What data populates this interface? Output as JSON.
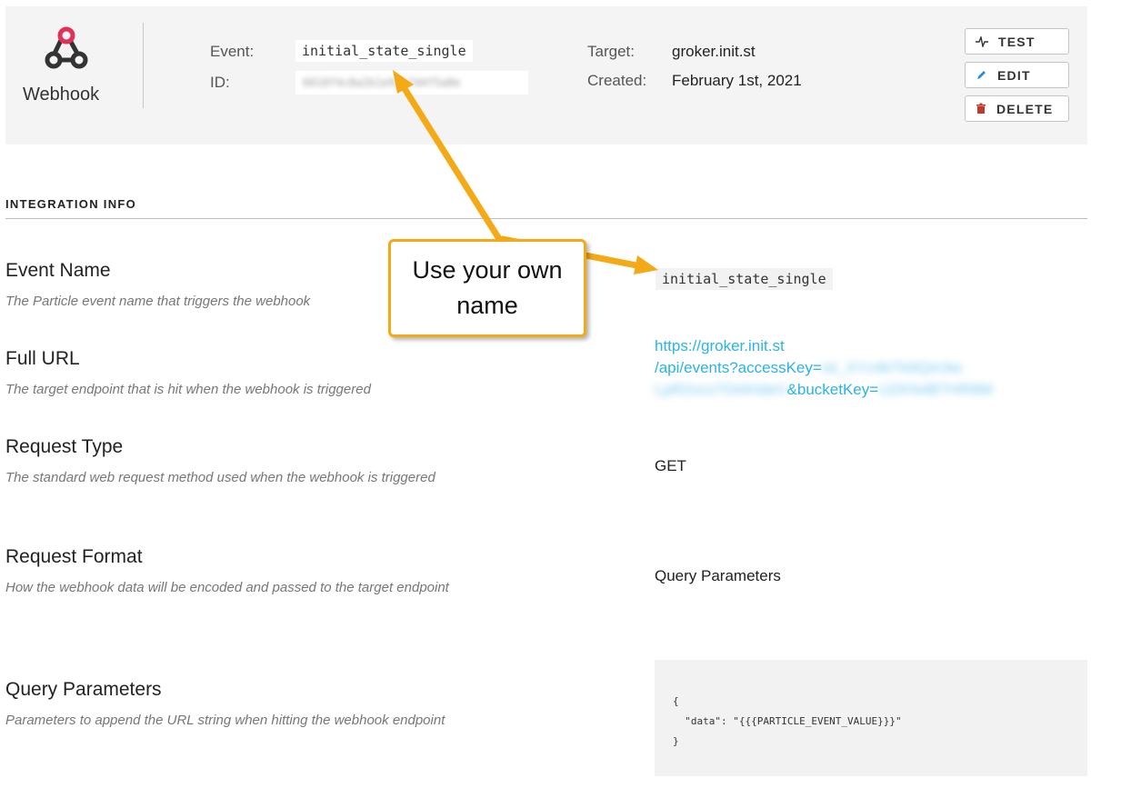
{
  "header": {
    "brand_label": "Webhook",
    "event_label": "Event:",
    "event_value": "initial_state_single",
    "id_label": "ID:",
    "id_value": "6018f4c8a2b1e93c7d4f5a0e",
    "target_label": "Target:",
    "target_value": "groker.init.st",
    "created_label": "Created:",
    "created_value": "February 1st, 2021",
    "buttons": {
      "test": "TEST",
      "edit": "EDIT",
      "delete": "DELETE"
    }
  },
  "section_title": "INTEGRATION INFO",
  "rows": {
    "event_name": {
      "title": "Event Name",
      "desc": "The Particle event name that triggers the webhook",
      "value": "initial_state_single"
    },
    "full_url": {
      "title": "Full URL",
      "desc": "The target endpoint that is hit when the webhook is triggered",
      "line1": "https://groker.init.st",
      "line2_prefix": "/api/events?accessKey=",
      "line2_hidden": "ist_XYz4bTk9Qm3w",
      "line3_hidden": "LpR2vcs7Gt4HdeV",
      "line3_suffix": "&bucketKey=",
      "line3_hidden2": "UZKN4BTHR8M"
    },
    "request_type": {
      "title": "Request Type",
      "desc": "The standard web request method used when the webhook is triggered",
      "value": "GET"
    },
    "request_format": {
      "title": "Request Format",
      "desc": "How the webhook data will be encoded and passed to the target endpoint",
      "value": "Query Parameters"
    },
    "query_params": {
      "title": "Query Parameters",
      "desc": "Parameters to append the URL string when hitting the webhook endpoint",
      "code": "{\n  \"data\": \"{{{PARTICLE_EVENT_VALUE}}}\"\n}"
    }
  },
  "annotation": {
    "text": "Use your own name"
  },
  "colors": {
    "accent": "#2bb3e6",
    "arrow": "#f3aa16",
    "header_bg": "#f4f4f4",
    "delete_icon": "#c0392b",
    "edit_icon": "#2b8fd6"
  }
}
